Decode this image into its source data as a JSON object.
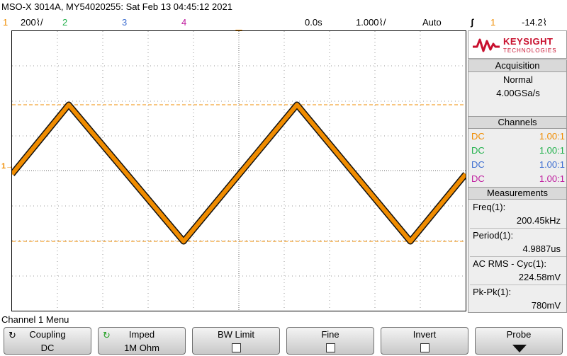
{
  "header": {
    "title": "MSO-X 3014A, MY54020255: Sat Feb 13 04:45:12 2021"
  },
  "status_bar": {
    "ch1_num": "1",
    "ch1_scale": "200⌇/",
    "ch2_num": "2",
    "ch3_num": "3",
    "ch4_num": "4",
    "time_delay": "0.0s",
    "time_scale": "1.000⌇/",
    "trigger_mode": "Auto",
    "trigger_slope": "ʃ",
    "trigger_source": "1",
    "trigger_level": "-14.2⌇"
  },
  "colors": {
    "ch1": "#f08c00",
    "ch2": "#22b14c",
    "ch3": "#3f6fd1",
    "ch4": "#c020a0",
    "brand": "#c8102e"
  },
  "logo": {
    "brand": "KEYSIGHT",
    "sub": "TECHNOLOGIES"
  },
  "acquisition": {
    "header": "Acquisition",
    "mode": "Normal",
    "rate": "4.00GSa/s"
  },
  "channels": {
    "header": "Channels",
    "rows": [
      {
        "coupling": "DC",
        "probe": "1.00:1"
      },
      {
        "coupling": "DC",
        "probe": "1.00:1"
      },
      {
        "coupling": "DC",
        "probe": "1.00:1"
      },
      {
        "coupling": "DC",
        "probe": "1.00:1"
      }
    ]
  },
  "measurements": {
    "header": "Measurements",
    "items": [
      {
        "label": "Freq(1):",
        "value": "200.45kHz"
      },
      {
        "label": "Period(1):",
        "value": "4.9887us"
      },
      {
        "label": "AC RMS - Cyc(1):",
        "value": "224.58mV"
      },
      {
        "label": "Pk-Pk(1):",
        "value": "780mV"
      }
    ]
  },
  "menu": {
    "title": "Channel 1 Menu"
  },
  "softkeys": {
    "coupling_label": "Coupling",
    "coupling_value": "DC",
    "imped_label": "Imped",
    "imped_value": "1M Ohm",
    "bwlimit_label": "BW Limit",
    "fine_label": "Fine",
    "invert_label": "Invert",
    "probe_label": "Probe"
  },
  "icons": {
    "cycle": "↻",
    "ch1_ground": "₀"
  }
}
